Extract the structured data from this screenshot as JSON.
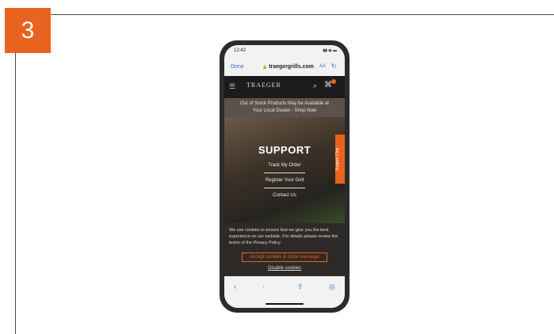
{
  "step": {
    "number": "3"
  },
  "colors": {
    "accent": "#e8641e",
    "link": "#2f6fd0"
  },
  "phone": {
    "status": {
      "time": "12:42",
      "icons": "▮▮ ◉ ▬"
    },
    "browser": {
      "done_label": "Done",
      "url": "traegergrills.com",
      "lock_icon": "🔒",
      "aa_label": "AA",
      "reload_icon": "↻"
    },
    "site_nav": {
      "menu_icon": "☰",
      "logo_text": "TRAEGER",
      "search_icon": "⌕",
      "cart_icon": "⌘"
    },
    "promo": {
      "line1": "Out of Stock Products May be Available at",
      "line2": "Your Local Dealer - Shop Now"
    },
    "hero": {
      "title": "SUPPORT",
      "buttons": [
        "Track My Order",
        "Register Your Grill",
        "Contact Us"
      ],
      "support_tab": "Support Chat"
    },
    "cookie": {
      "text": "We use cookies to ensure that we give you the best experience on our website. For details please review the terms of the Privacy Policy.",
      "accept_label": "Accept cookies & close message",
      "disable_label": "Disable cookies"
    },
    "toolbar": {
      "back_icon": "‹",
      "forward_icon": "›",
      "share_icon": "⇧",
      "compass_icon": "◎"
    }
  }
}
